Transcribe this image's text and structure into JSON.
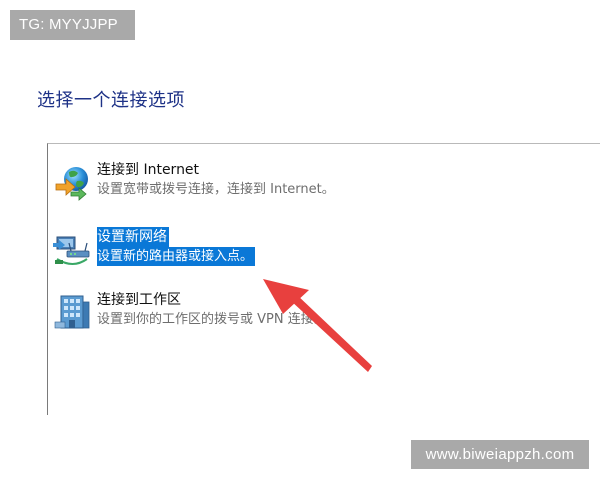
{
  "watermark_top": "TG: MYYJJPP",
  "watermark_bottom": "www.biweiappzh.com",
  "heading": "选择一个连接选项",
  "options": [
    {
      "title": "连接到 Internet",
      "description": "设置宽带或拨号连接，连接到 Internet。",
      "icon": "internet-globe-icon",
      "selected": false
    },
    {
      "title": "设置新网络",
      "description": "设置新的路由器或接入点。",
      "icon": "new-network-icon",
      "selected": true
    },
    {
      "title": "连接到工作区",
      "description": "设置到你的工作区的拨号或 VPN 连接。",
      "icon": "workplace-icon",
      "selected": false
    }
  ],
  "colors": {
    "selection": "#0a78d7",
    "heading": "#1e3287",
    "annotation_arrow": "#e8403e",
    "watermark_bg": "#a9a9a9"
  }
}
